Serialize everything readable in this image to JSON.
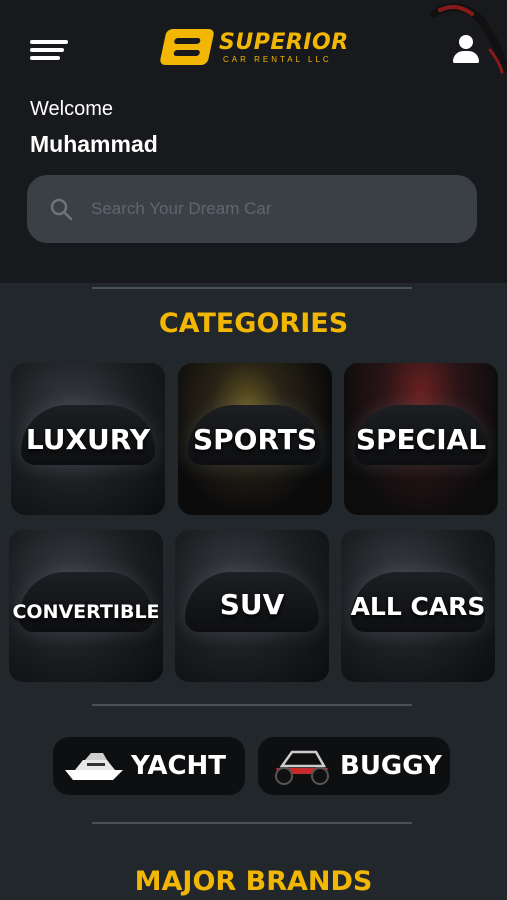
{
  "header": {
    "brand_title": "SUPERIOR",
    "brand_subtitle": "CAR RENTAL LLC",
    "icons": {
      "menu": "hamburger-menu-icon",
      "account": "user-icon"
    }
  },
  "greeting": {
    "welcome": "Welcome",
    "name": "Muhammad"
  },
  "search": {
    "placeholder": "Search Your Dream Car",
    "value": "",
    "icon": "search-icon"
  },
  "categories": {
    "title": "CATEGORIES",
    "items": [
      {
        "label": "LUXURY"
      },
      {
        "label": "SPORTS"
      },
      {
        "label": "SPECIAL"
      },
      {
        "label": "CONVERTIBLE"
      },
      {
        "label": "SUV"
      },
      {
        "label": "ALL CARS"
      }
    ]
  },
  "extras": [
    {
      "label": "YACHT",
      "icon": "yacht-icon"
    },
    {
      "label": "BUGGY",
      "icon": "buggy-icon"
    }
  ],
  "brands": {
    "title": "MAJOR BRANDS"
  },
  "colors": {
    "accent": "#f2b705",
    "header_bg": "#17191c",
    "page_bg": "#22272c",
    "search_bg": "#3a4046"
  }
}
